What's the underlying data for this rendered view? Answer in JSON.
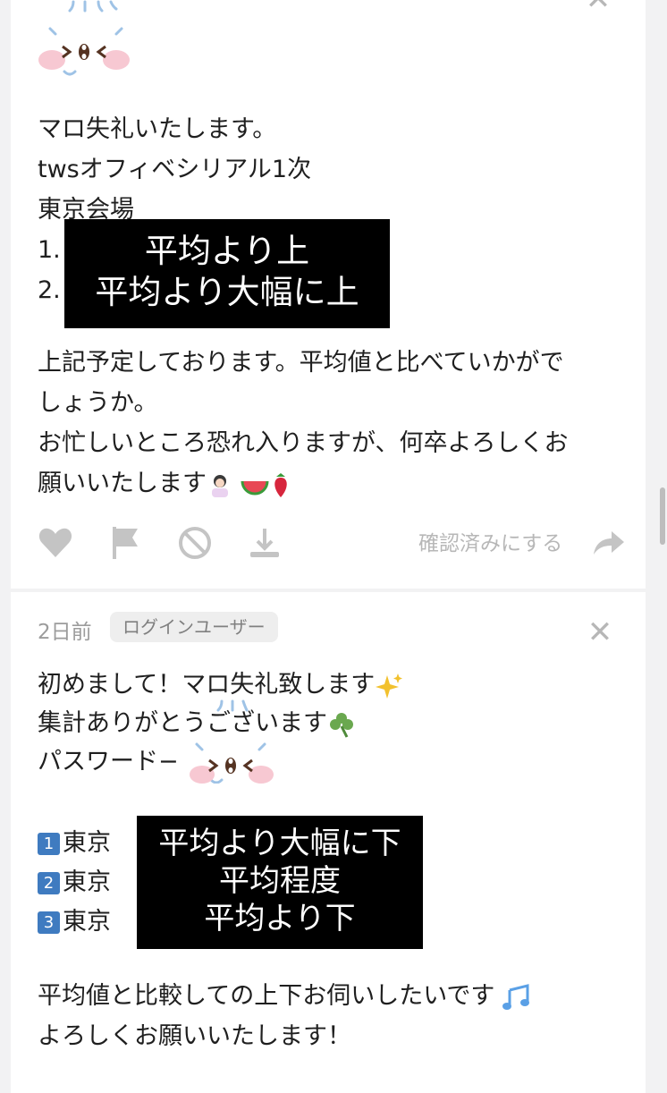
{
  "post1": {
    "lines": [
      "マロ失礼いたします。",
      "twsオフィベシリアル1次",
      "東京会場",
      "1.",
      "2."
    ],
    "redacted": [
      "平均より上",
      "平均より大幅に上"
    ],
    "body": [
      "上記予定しております。平均値と比べていかがで",
      "しょうか。",
      "お忙しいところ恐れ入りますが、何卒よろしくお",
      "願いいたします"
    ],
    "confirm_label": "確認済みにする",
    "icons": [
      "heart-icon",
      "flag-icon",
      "block-icon",
      "download-icon",
      "share-arrow-icon"
    ]
  },
  "post2": {
    "time": "2日前",
    "badge": "ログインユーザー",
    "lines": [
      "初めまして！マロ失礼致します",
      "集計ありがとうございます",
      "パスワード−"
    ],
    "items": [
      {
        "num": "1",
        "label": "東京"
      },
      {
        "num": "2",
        "label": "東京"
      },
      {
        "num": "3",
        "label": "東京"
      }
    ],
    "redacted": [
      "平均より大幅に下",
      "平均程度",
      "平均より下"
    ],
    "body": [
      "平均値と比較しての上下お伺いしたいです",
      "よろしくお願いいたします！"
    ]
  },
  "colors": {
    "background": "#f2f2f3",
    "card": "#ffffff",
    "muted": "#b7b7b7",
    "redaction": "#000000",
    "keycap": "#3f7bc0"
  }
}
